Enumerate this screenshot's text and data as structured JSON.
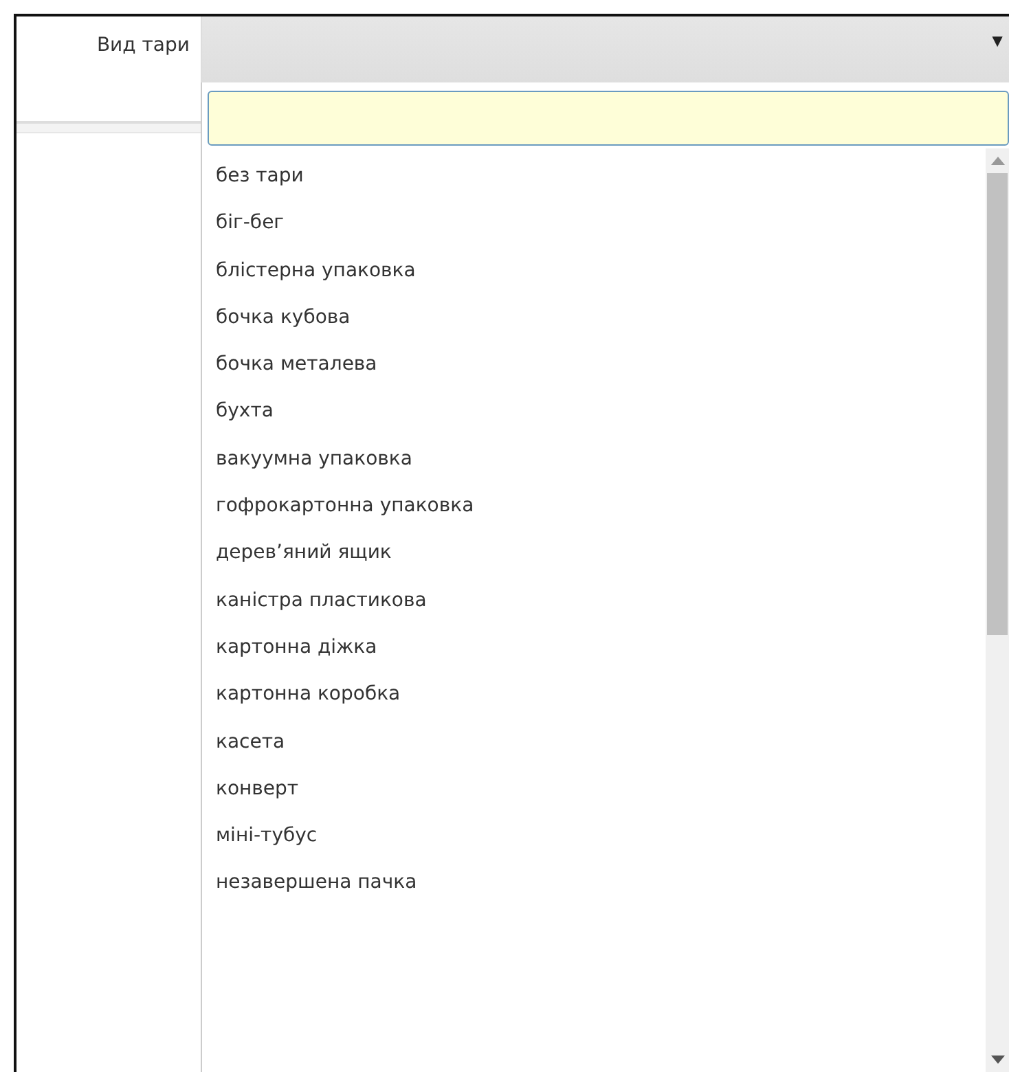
{
  "field": {
    "label": "Вид тари",
    "arrow": "▼"
  },
  "dropdown": {
    "options": [
      {
        "label": "без тари"
      },
      {
        "label": "біг-бег"
      },
      {
        "label": "блістерна упаковка"
      },
      {
        "label": "бочка кубова"
      },
      {
        "label": "бочка металева"
      },
      {
        "label": "бухта"
      },
      {
        "label": "вакуумна упаковка"
      },
      {
        "label": "гофрокартонна упаковка"
      },
      {
        "label": "дерев’яний ящик"
      },
      {
        "label": "каністра пластикова"
      },
      {
        "label": "картонна діжка"
      },
      {
        "label": "картонна коробка"
      },
      {
        "label": "касета"
      },
      {
        "label": "конверт"
      },
      {
        "label": "міні-тубус"
      },
      {
        "label": "незавершена пачка"
      }
    ]
  }
}
